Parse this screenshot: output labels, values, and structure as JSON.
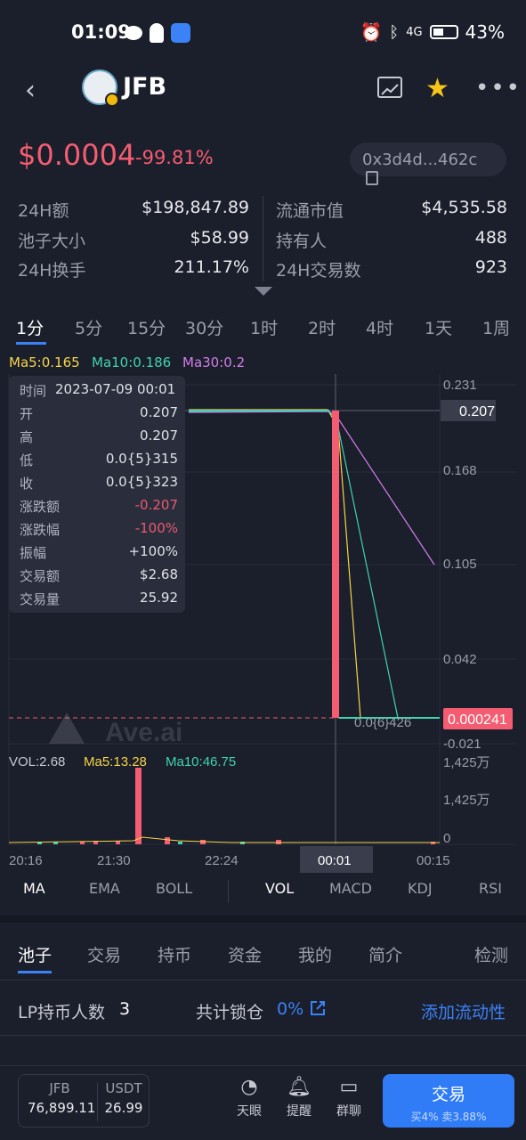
{
  "status": {
    "time": "01:09",
    "battery": "43%",
    "network": "4G"
  },
  "header": {
    "back_icon": "chevron-left-icon",
    "token": "JFB",
    "chart_icon": "chart-icon",
    "star_icon": "star-icon",
    "more_icon": "more-icon"
  },
  "price": {
    "value": "$0.0004",
    "change": "-99.81%",
    "address": "0x3d4d...462c"
  },
  "stats": {
    "vol24_label": "24H额",
    "vol24": "$198,847.89",
    "pool_label": "池子大小",
    "pool": "$58.99",
    "turnover_label": "24H换手",
    "turnover": "211.17%",
    "mcap_label": "流通市值",
    "mcap": "$4,535.58",
    "holders_label": "持有人",
    "holders": "488",
    "tx24_label": "24H交易数",
    "tx24": "923"
  },
  "timeframes": [
    "1分",
    "5分",
    "15分",
    "30分",
    "1时",
    "2时",
    "4时",
    "1天",
    "1周"
  ],
  "ma": {
    "ma5": "Ma5:0.165",
    "ma10": "Ma10:0.186",
    "ma30": "Ma30:0.2"
  },
  "tooltip": [
    {
      "k": "时间",
      "v": "2023-07-09 00:01"
    },
    {
      "k": "开",
      "v": "0.207"
    },
    {
      "k": "高",
      "v": "0.207"
    },
    {
      "k": "低",
      "v": "0.0{5}315"
    },
    {
      "k": "收",
      "v": "0.0{5}323"
    },
    {
      "k": "涨跌额",
      "v": "-0.207"
    },
    {
      "k": "涨跌幅",
      "v": "-100%"
    },
    {
      "k": "振幅",
      "v": "+100%"
    },
    {
      "k": "交易额",
      "v": "$2.68"
    },
    {
      "k": "交易量",
      "v": "25.92"
    }
  ],
  "chart_data": {
    "type": "line",
    "title": "",
    "y_ticks": [
      "0.231",
      "0.168",
      "0.105",
      "0.042",
      "-0.021"
    ],
    "current_price_label": "0.207",
    "last_price_label": "0.000241",
    "min_label": "0.0{6}426",
    "x_ticks": [
      "20:16",
      "21:30",
      "22:24",
      "00:01",
      "00:15"
    ],
    "volume": {
      "vol": "VOL:2.68",
      "ma5": "Ma5:13.28",
      "ma10": "Ma10:46.75",
      "y_ticks": [
        "1,425万",
        "1,425万",
        "0"
      ]
    },
    "watermark": "Ave.ai"
  },
  "indicators": [
    "MA",
    "EMA",
    "BOLL",
    "VOL",
    "MACD",
    "KDJ",
    "RSI"
  ],
  "bottom_tabs": [
    "池子",
    "交易",
    "持币",
    "资金",
    "我的",
    "简介",
    "检测"
  ],
  "lp": {
    "holders_label": "LP持币人数",
    "holders": "3",
    "locked_label": "共计锁仓",
    "locked": "0%",
    "add": "添加流动性"
  },
  "footer": {
    "pair_a": "JFB",
    "pair_a_amt": "76,899.11",
    "pair_b": "USDT",
    "pair_b_amt": "26.99",
    "tianyan": "天眼",
    "remind": "提醒",
    "group": "群聊",
    "trade": "交易",
    "fees": "买4% 卖3.88%"
  }
}
